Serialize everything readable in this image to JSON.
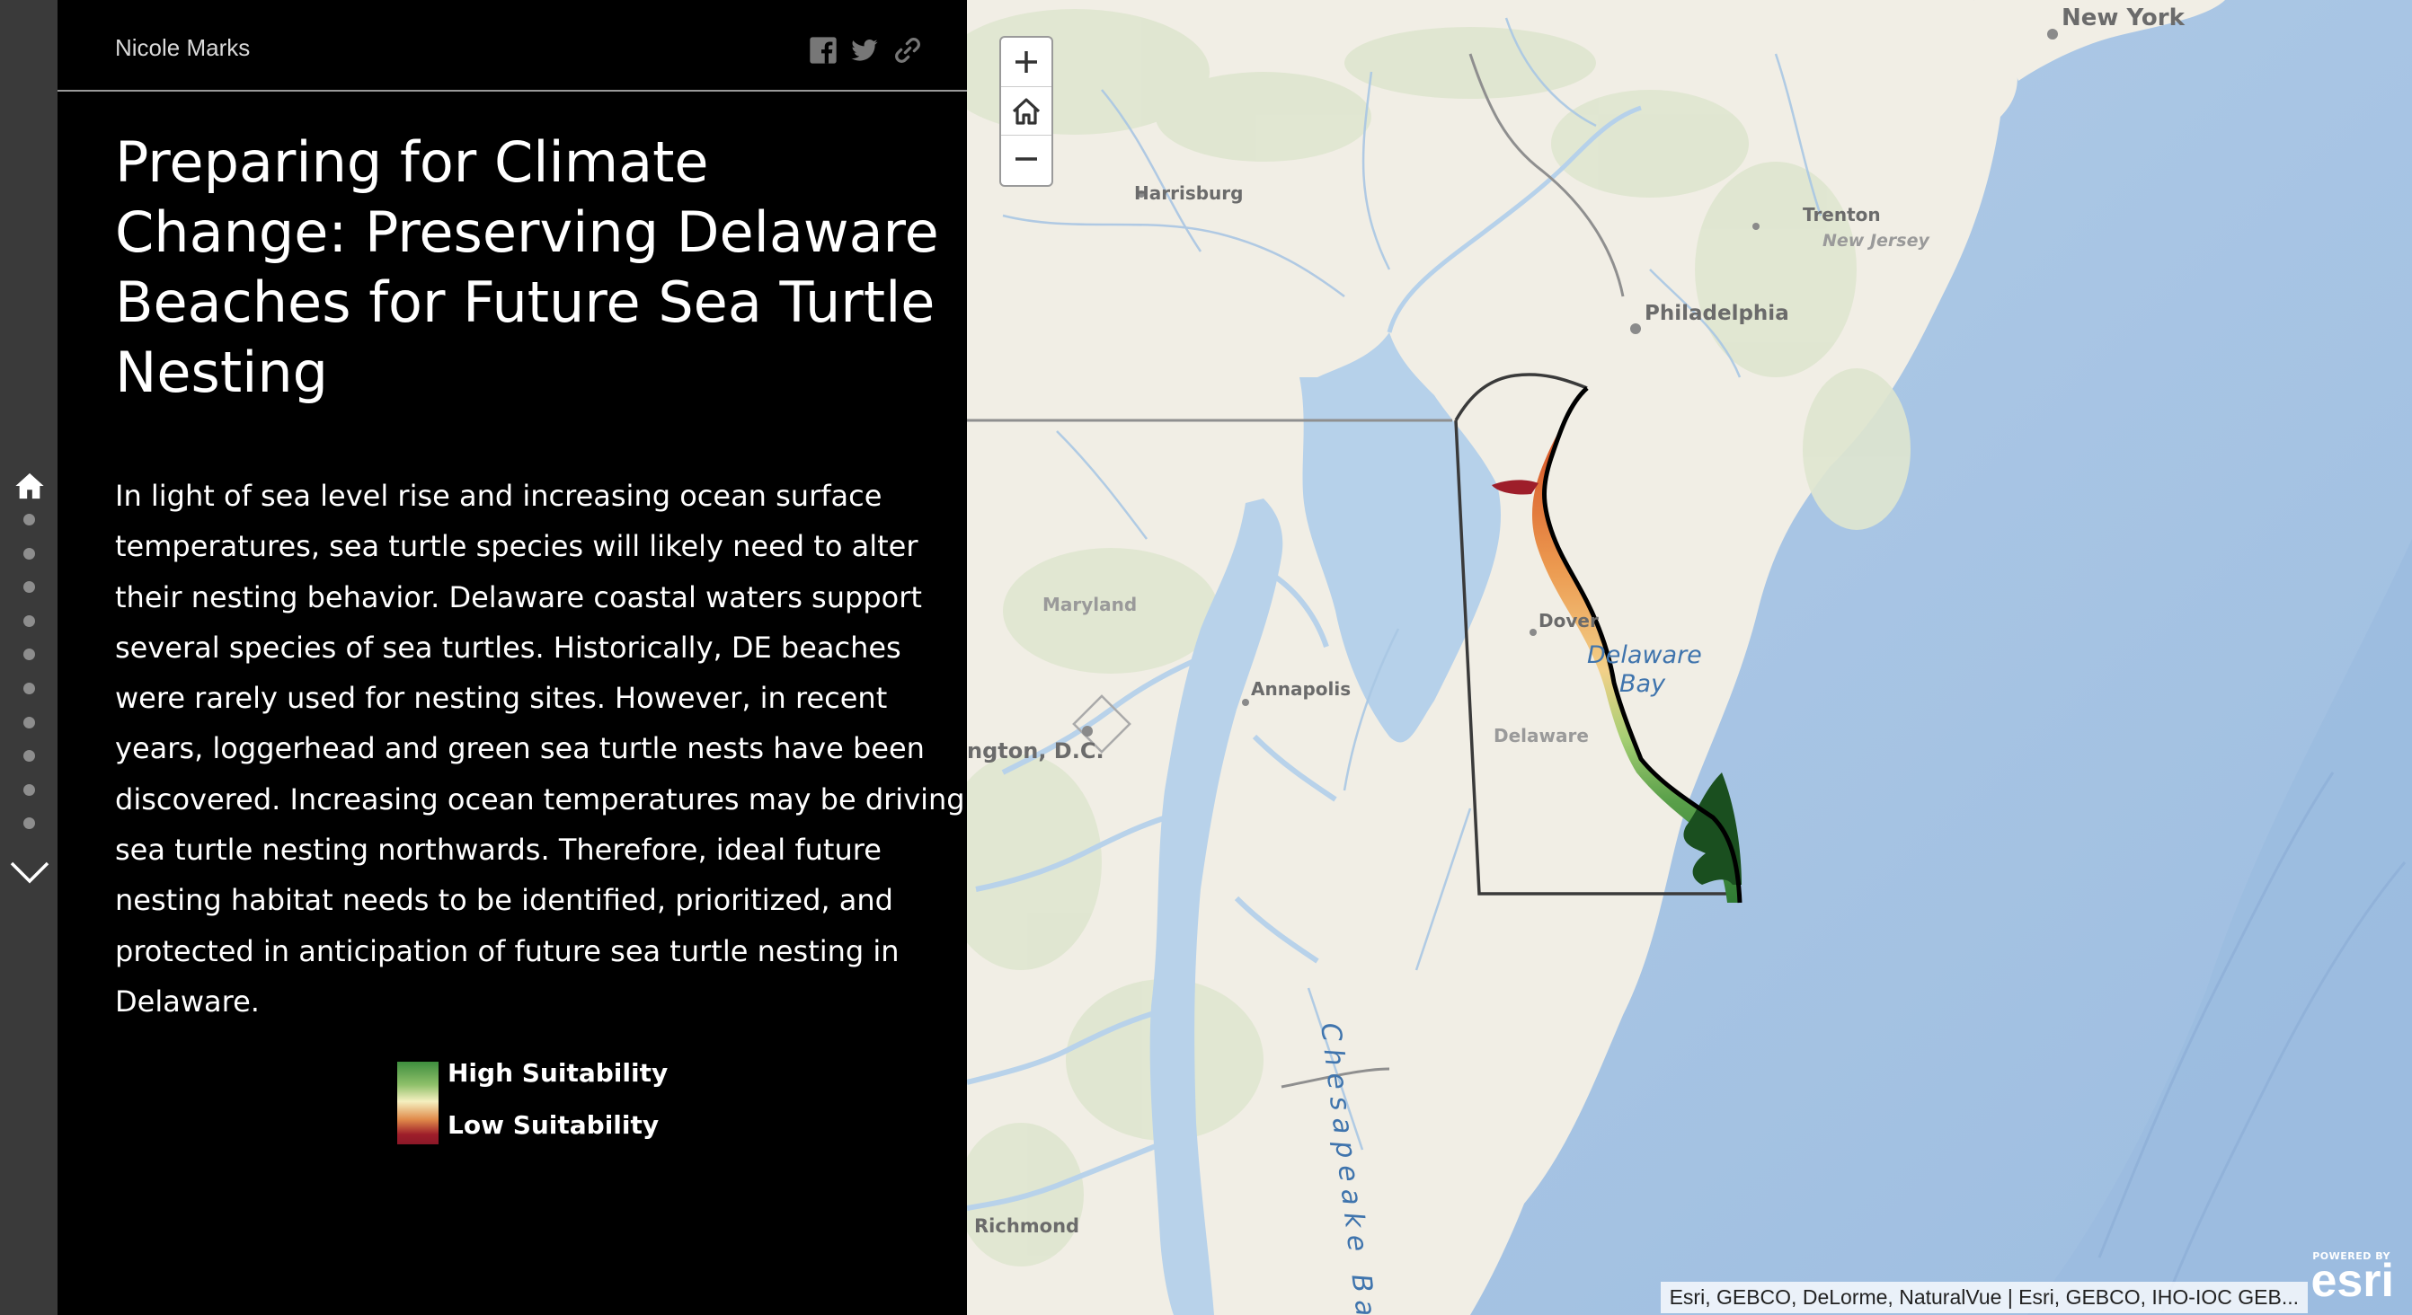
{
  "header": {
    "author": "Nicole Marks"
  },
  "story": {
    "title": "Preparing for Climate Change: Preserving Delaware Beaches for Future Sea Turtle Nesting",
    "body": "In light of sea level rise and increasing ocean surface temperatures, sea turtle species will likely need to alter their nesting behavior. Delaware coastal waters support several species of sea turtles. Historically, DE beaches were rarely used for nesting sites. However, in recent years, loggerhead and green sea turtle nests have been discovered. Increasing ocean temperatures may be driving sea turtle nesting northwards. Therefore, ideal future nesting habitat needs to be identified, prioritized, and protected in anticipation of future sea turtle nesting in Delaware."
  },
  "legend": {
    "high": "High Suitability",
    "low": "Low Suitability",
    "colors": [
      "#3e8e3e",
      "#f5f0c0",
      "#9e1e2a"
    ]
  },
  "nav": {
    "icons": [
      "home-icon",
      "chevron-down-icon"
    ],
    "section_count": 10
  },
  "share": {
    "icons": [
      "facebook-icon",
      "twitter-icon",
      "link-icon"
    ]
  },
  "map": {
    "labels": {
      "new_york": "New York",
      "harrisburg": "Harrisburg",
      "trenton": "Trenton",
      "new_jersey": "New Jersey",
      "philadelphia": "Philadelphia",
      "maryland": "Maryland",
      "dover": "Dover",
      "delaware_bay_1": "Delaware",
      "delaware_bay_2": "Bay",
      "annapolis": "Annapolis",
      "washington": "ngton, D.C.",
      "delaware": "Delaware",
      "chesapeake": "Chesapeake Bay",
      "richmond": "Richmond"
    },
    "attribution": "Esri, GEBCO, DeLorme, NaturalVue | Esri, GEBCO, IHO-IOC GEB...",
    "powered_by": "POWERED BY",
    "brand": "esri",
    "colors": {
      "land": "#f2efe6",
      "water": "#b5d0ea",
      "ocean": "#a9c6e4"
    }
  }
}
